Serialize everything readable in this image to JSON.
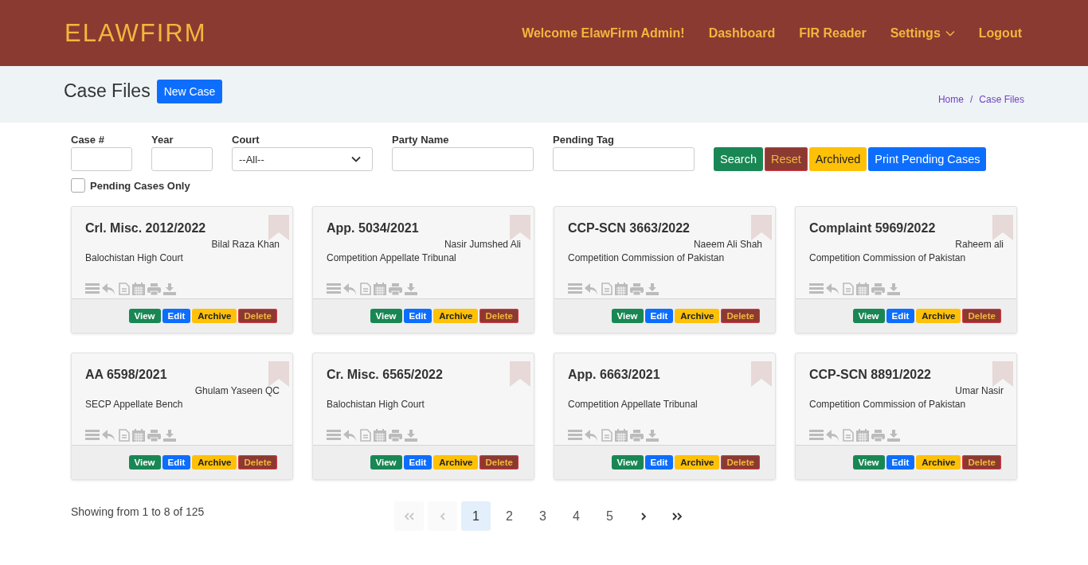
{
  "header": {
    "logo": "ELAWFIRM",
    "nav": [
      {
        "label": "Welcome ElawFirm Admin!",
        "kind": "link"
      },
      {
        "label": "Dashboard",
        "kind": "link"
      },
      {
        "label": "FIR Reader",
        "kind": "link"
      },
      {
        "label": "Settings",
        "kind": "dropdown"
      },
      {
        "label": "Logout",
        "kind": "link"
      }
    ]
  },
  "page": {
    "title": "Case Files",
    "new_button": "New Case",
    "breadcrumb": [
      {
        "label": "Home"
      },
      {
        "label": "Case Files"
      }
    ],
    "breadcrumb_separator": "/"
  },
  "filters": {
    "fields": [
      {
        "label": "Case #",
        "kind": "text"
      },
      {
        "label": "Year",
        "kind": "text"
      },
      {
        "label": "Court",
        "kind": "select",
        "value": "--All--"
      },
      {
        "label": "Party Name",
        "kind": "text"
      },
      {
        "label": "Pending Tag",
        "kind": "text"
      }
    ],
    "buttons": [
      {
        "label": "Search",
        "kind": "success"
      },
      {
        "label": "Reset",
        "kind": "danger"
      },
      {
        "label": "Archived",
        "kind": "warning"
      },
      {
        "label": "Print Pending Cases",
        "kind": "primary"
      }
    ],
    "pending_only": {
      "label": "Pending Cases Only",
      "checked": false
    }
  },
  "cards": [
    {
      "title": "Crl. Misc. 2012/2022",
      "party": "Bilal Raza Khan",
      "court": "Balochistan High Court",
      "buttons": [
        {
          "label": "View",
          "kind": "success"
        },
        {
          "label": "Edit",
          "kind": "primary"
        },
        {
          "label": "Archive",
          "kind": "warning"
        },
        {
          "label": "Delete",
          "kind": "danger"
        }
      ]
    },
    {
      "title": "App. 5034/2021",
      "party": "Nasir Jumshed Ali",
      "court": "Competition Appellate Tribunal",
      "buttons": [
        {
          "label": "View",
          "kind": "success"
        },
        {
          "label": "Edit",
          "kind": "primary"
        },
        {
          "label": "Archive",
          "kind": "warning"
        },
        {
          "label": "Delete",
          "kind": "danger"
        }
      ]
    },
    {
      "title": "CCP-SCN 3663/2022",
      "party": "Naeem Ali Shah",
      "court": "Competition Commission of Pakistan",
      "buttons": [
        {
          "label": "View",
          "kind": "success"
        },
        {
          "label": "Edit",
          "kind": "primary"
        },
        {
          "label": "Archive",
          "kind": "warning"
        },
        {
          "label": "Delete",
          "kind": "danger"
        }
      ]
    },
    {
      "title": "Complaint 5969/2022",
      "party": "Raheem ali",
      "court": "Competition Commission of Pakistan",
      "buttons": [
        {
          "label": "View",
          "kind": "success"
        },
        {
          "label": "Edit",
          "kind": "primary"
        },
        {
          "label": "Archive",
          "kind": "warning"
        },
        {
          "label": "Delete",
          "kind": "danger"
        }
      ]
    },
    {
      "title": "AA 6598/2021",
      "party": "Ghulam Yaseen QC",
      "court": "SECP Appellate Bench",
      "buttons": [
        {
          "label": "View",
          "kind": "success"
        },
        {
          "label": "Edit",
          "kind": "primary"
        },
        {
          "label": "Archive",
          "kind": "warning"
        },
        {
          "label": "Delete",
          "kind": "danger"
        }
      ]
    },
    {
      "title": "Cr. Misc. 6565/2022",
      "court": "Balochistan High Court",
      "buttons": [
        {
          "label": "View",
          "kind": "success"
        },
        {
          "label": "Edit",
          "kind": "primary"
        },
        {
          "label": "Archive",
          "kind": "warning"
        },
        {
          "label": "Delete",
          "kind": "danger"
        }
      ]
    },
    {
      "title": "App. 6663/2021",
      "court": "Competition Appellate Tribunal",
      "buttons": [
        {
          "label": "View",
          "kind": "success"
        },
        {
          "label": "Edit",
          "kind": "primary"
        },
        {
          "label": "Archive",
          "kind": "warning"
        },
        {
          "label": "Delete",
          "kind": "danger"
        }
      ]
    },
    {
      "title": "CCP-SCN 8891/2022",
      "party": "Umar Nasir",
      "court": "Competition Commission of Pakistan",
      "buttons": [
        {
          "label": "View",
          "kind": "success"
        },
        {
          "label": "Edit",
          "kind": "primary"
        },
        {
          "label": "Archive",
          "kind": "warning"
        },
        {
          "label": "Delete",
          "kind": "danger"
        }
      ]
    }
  ],
  "footer": {
    "showing": "Showing from 1 to 8 of 125",
    "pagination": [
      {
        "kind": "first",
        "disabled": true
      },
      {
        "kind": "prev",
        "disabled": true
      },
      {
        "kind": "page",
        "label": "1",
        "selected": true
      },
      {
        "kind": "page",
        "label": "2",
        "selected": false
      },
      {
        "kind": "page",
        "label": "3",
        "selected": false
      },
      {
        "kind": "page",
        "label": "4",
        "selected": false
      },
      {
        "kind": "page",
        "label": "5",
        "selected": false
      },
      {
        "kind": "next",
        "disabled": false
      },
      {
        "kind": "last",
        "disabled": false
      }
    ]
  }
}
